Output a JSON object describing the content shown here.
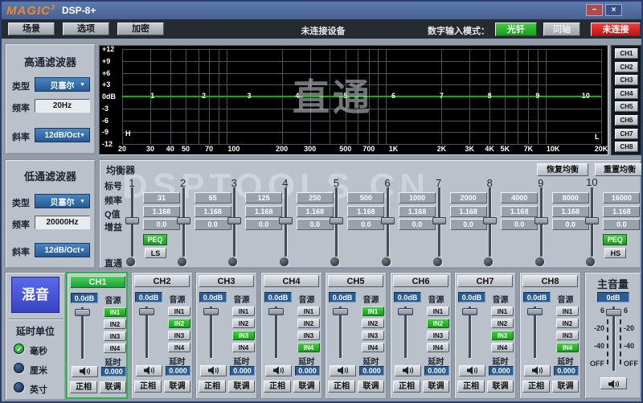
{
  "colors": {
    "accent_green": "#2db52d",
    "value_blue": "#2a5d95",
    "alert_red": "#d01818",
    "mix_blue": "#4653d4",
    "curve_green": "#00b800",
    "logo_orange": "#f08828"
  },
  "window": {
    "logo": "MAGIC",
    "logo_sup": "3",
    "title": "DSP-8+",
    "minimize": "−",
    "close": "×"
  },
  "toolbar": {
    "menus": [
      "场景",
      "选项",
      "加密"
    ],
    "device_status": "未连接设备",
    "digital_mode_label": "数字输入模式：",
    "optical": "光钎",
    "coaxial": "同轴",
    "connect": "未连接"
  },
  "hpf": {
    "title": "高通滤波器",
    "type_label": "类型",
    "type_value": "贝塞尔",
    "freq_label": "频率",
    "freq_value": "20Hz",
    "slope_label": "斜率",
    "slope_value": "12dB/Oct"
  },
  "lpf": {
    "title": "低通滤波器",
    "type_label": "类型",
    "type_value": "贝塞尔",
    "freq_label": "频率",
    "freq_value": "20000Hz",
    "slope_label": "斜率",
    "slope_value": "12dB/Oct"
  },
  "graph": {
    "watermark": "直通",
    "y_ticks": [
      "+12",
      "+9",
      "+6",
      "+3",
      "0dB",
      "-3",
      "-6",
      "-9",
      "-12"
    ],
    "x_ticks": [
      {
        "label": "20",
        "f": 20
      },
      {
        "label": "30",
        "f": 30
      },
      {
        "label": "40",
        "f": 40
      },
      {
        "label": "50",
        "f": 50
      },
      {
        "label": "70",
        "f": 70
      },
      {
        "label": "100",
        "f": 100
      },
      {
        "label": "200",
        "f": 200
      },
      {
        "label": "300",
        "f": 300
      },
      {
        "label": "500",
        "f": 500
      },
      {
        "label": "700",
        "f": 700
      },
      {
        "label": "1K",
        "f": 1000
      },
      {
        "label": "2K",
        "f": 2000
      },
      {
        "label": "3K",
        "f": 3000
      },
      {
        "label": "4K",
        "f": 4000
      },
      {
        "label": "5K",
        "f": 5000
      },
      {
        "label": "7K",
        "f": 7000
      },
      {
        "label": "10K",
        "f": 10000
      },
      {
        "label": "20K",
        "f": 20000
      }
    ],
    "points": [
      {
        "label": "1",
        "f": 31
      },
      {
        "label": "2",
        "f": 65
      },
      {
        "label": "3",
        "f": 125
      },
      {
        "label": "4",
        "f": 250
      },
      {
        "label": "5",
        "f": 500
      },
      {
        "label": "6",
        "f": 1000
      },
      {
        "label": "7",
        "f": 2000
      },
      {
        "label": "8",
        "f": 4000
      },
      {
        "label": "9",
        "f": 8000
      },
      {
        "label": "10",
        "f": 16000
      }
    ],
    "markers": {
      "low": "H",
      "high": "L"
    }
  },
  "channel_tabs": [
    "CH1",
    "CH2",
    "CH3",
    "CH4",
    "CH5",
    "CH6",
    "CH7",
    "CH8"
  ],
  "eq": {
    "title": "均衡器",
    "restore_button": "恢复均衡",
    "reset_button": "重置均衡",
    "row_labels": {
      "index": "标号",
      "freq": "频率",
      "q": "Q值",
      "gain": "增益",
      "bypass": "直通"
    },
    "bands": [
      {
        "num": "1",
        "freq": "31",
        "q": "1.168",
        "gain": "0.0"
      },
      {
        "num": "2",
        "freq": "65",
        "q": "1.168",
        "gain": "0.0"
      },
      {
        "num": "3",
        "freq": "125",
        "q": "1.168",
        "gain": "0.0"
      },
      {
        "num": "4",
        "freq": "250",
        "q": "1.168",
        "gain": "0.0"
      },
      {
        "num": "5",
        "freq": "500",
        "q": "1.168",
        "gain": "0.0"
      },
      {
        "num": "6",
        "freq": "1000",
        "q": "1.168",
        "gain": "0.0"
      },
      {
        "num": "7",
        "freq": "2000",
        "q": "1.168",
        "gain": "0.0"
      },
      {
        "num": "8",
        "freq": "4000",
        "q": "1.168",
        "gain": "0.0"
      },
      {
        "num": "9",
        "freq": "8000",
        "q": "1.168",
        "gain": "0.0"
      },
      {
        "num": "10",
        "freq": "16000",
        "q": "1.168",
        "gain": "0.0"
      }
    ],
    "band1_buttons": [
      "PEQ",
      "LS"
    ],
    "band10_buttons": [
      "PEQ",
      "HS"
    ],
    "watermark": "DSPTOOLS.CN"
  },
  "mixer_left": {
    "mix_button": "混音",
    "delay_unit_title": "延时单位",
    "units": [
      {
        "label": "毫秒",
        "selected": true
      },
      {
        "label": "厘米",
        "selected": false
      },
      {
        "label": "英寸",
        "selected": false
      }
    ]
  },
  "strips": [
    {
      "name": "CH1",
      "active": true,
      "gain": "0.0dB",
      "source_label": "音源",
      "inputs": [
        "IN1",
        "IN2",
        "IN3",
        "IN4"
      ],
      "selected_input": 0,
      "delay_label": "延时",
      "delay_value": "0.000",
      "phase_button": "正相",
      "link_button": "联调"
    },
    {
      "name": "CH2",
      "active": false,
      "gain": "0.0dB",
      "source_label": "音源",
      "inputs": [
        "IN1",
        "IN2",
        "IN3",
        "IN4"
      ],
      "selected_input": 1,
      "delay_label": "延时",
      "delay_value": "0.000",
      "phase_button": "正相",
      "link_button": "联调"
    },
    {
      "name": "CH3",
      "active": false,
      "gain": "0.0dB",
      "source_label": "音源",
      "inputs": [
        "IN1",
        "IN2",
        "IN3",
        "IN4"
      ],
      "selected_input": 2,
      "delay_label": "延时",
      "delay_value": "0.000",
      "phase_button": "正相",
      "link_button": "联调"
    },
    {
      "name": "CH4",
      "active": false,
      "gain": "0.0dB",
      "source_label": "音源",
      "inputs": [
        "IN1",
        "IN2",
        "IN3",
        "IN4"
      ],
      "selected_input": 3,
      "delay_label": "延时",
      "delay_value": "0.000",
      "phase_button": "正相",
      "link_button": "联调"
    },
    {
      "name": "CH5",
      "active": false,
      "gain": "0.0dB",
      "source_label": "音源",
      "inputs": [
        "IN1",
        "IN2",
        "IN3",
        "IN4"
      ],
      "selected_input": 0,
      "delay_label": "延时",
      "delay_value": "0.000",
      "phase_button": "正相",
      "link_button": "联调"
    },
    {
      "name": "CH6",
      "active": false,
      "gain": "0.0dB",
      "source_label": "音源",
      "inputs": [
        "IN1",
        "IN2",
        "IN3",
        "IN4"
      ],
      "selected_input": 1,
      "delay_label": "延时",
      "delay_value": "0.000",
      "phase_button": "正相",
      "link_button": "联调"
    },
    {
      "name": "CH7",
      "active": false,
      "gain": "0.0dB",
      "source_label": "音源",
      "inputs": [
        "IN1",
        "IN2",
        "IN3",
        "IN4"
      ],
      "selected_input": 2,
      "delay_label": "延时",
      "delay_value": "0.000",
      "phase_button": "正相",
      "link_button": "联调"
    },
    {
      "name": "CH8",
      "active": false,
      "gain": "0.0dB",
      "source_label": "音源",
      "inputs": [
        "IN1",
        "IN2",
        "IN3",
        "IN4"
      ],
      "selected_input": 3,
      "delay_label": "延时",
      "delay_value": "0.000",
      "phase_button": "正相",
      "link_button": "联调"
    }
  ],
  "master": {
    "title": "主音量",
    "value": "0dB",
    "scale_labels": [
      "6",
      "-20",
      "-40",
      "OFF"
    ]
  }
}
